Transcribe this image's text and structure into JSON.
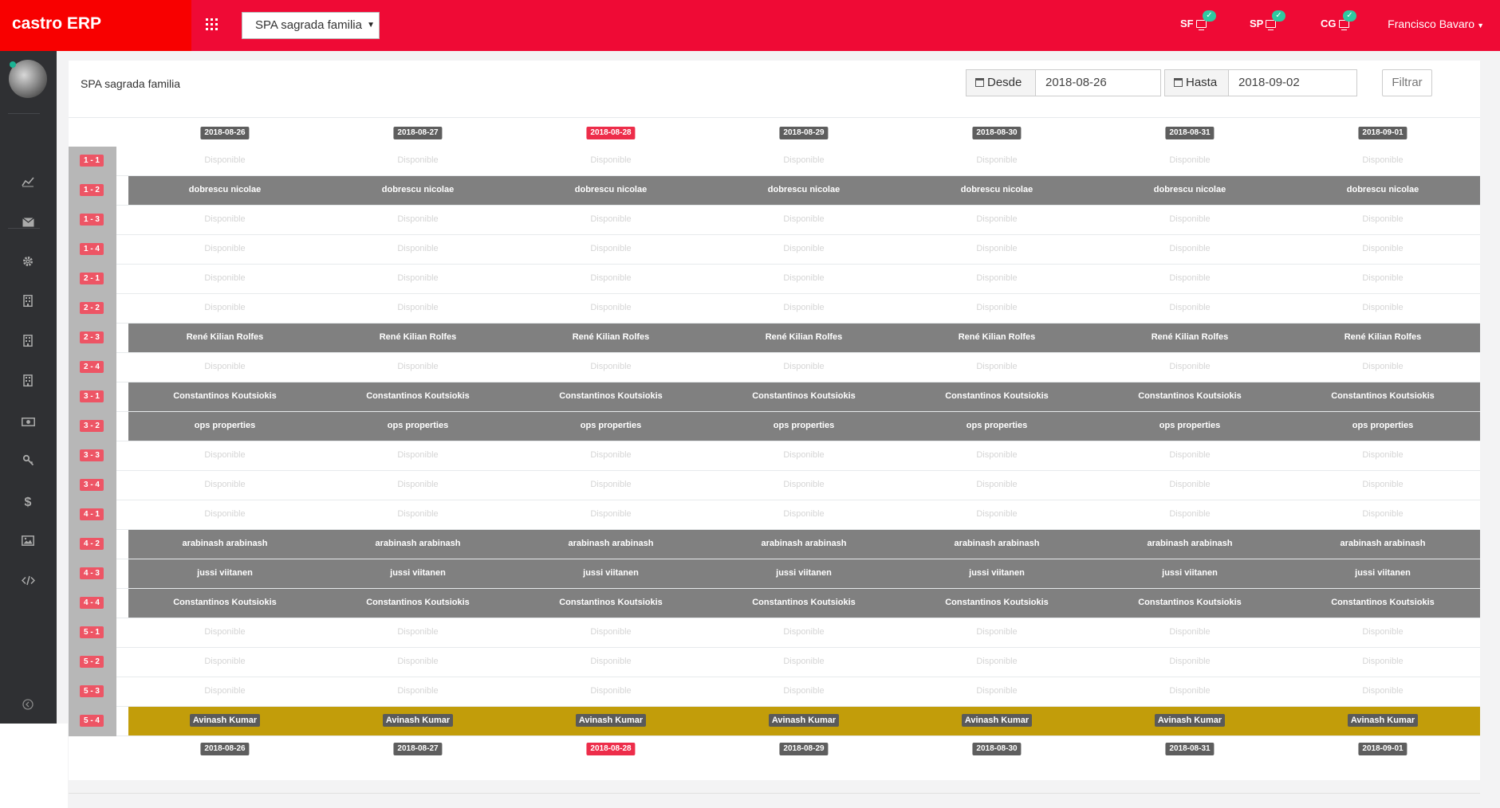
{
  "app": {
    "brand": "castro ERP",
    "company": "SPA sagrada familia",
    "user": "Francisco Bavaro"
  },
  "shops": [
    {
      "code": "SF",
      "status": "online"
    },
    {
      "code": "SP",
      "status": "online"
    },
    {
      "code": "CG",
      "status": "online"
    }
  ],
  "sidebar": {
    "items": [
      {
        "icon": "chart-line-icon"
      },
      {
        "icon": "envelope-icon"
      },
      {
        "icon": "gear-icon"
      },
      {
        "icon": "building-icon"
      },
      {
        "icon": "building-icon"
      },
      {
        "icon": "building-icon"
      },
      {
        "icon": "money-icon"
      },
      {
        "icon": "key-icon"
      },
      {
        "icon": "dollar-icon"
      },
      {
        "icon": "image-icon"
      },
      {
        "icon": "code-icon"
      }
    ],
    "collapse_icon": "circle-chevron-left-icon"
  },
  "page": {
    "title": "SPA sagrada familia"
  },
  "filter": {
    "from_label": "Desde",
    "from_value": "2018-08-26",
    "to_label": "Hasta",
    "to_value": "2018-09-02",
    "button": "Filtrar"
  },
  "dates": [
    "2018-08-26",
    "2018-08-27",
    "2018-08-28",
    "2018-08-29",
    "2018-08-30",
    "2018-08-31",
    "2018-09-01"
  ],
  "today": "2018-08-28",
  "free_text": "Disponible",
  "colors": {
    "topbar": "#ef0a35",
    "brand": "#f80000",
    "occupied": "#808080",
    "highlight": "#c29d0a",
    "room_badge": "#ed5565",
    "today_badge": "#ed2d4a"
  },
  "rows": [
    {
      "room": "1 - 1",
      "guest": null,
      "style": "free"
    },
    {
      "room": "1 - 2",
      "guest": "dobrescu nicolae",
      "style": "occ"
    },
    {
      "room": "1 - 3",
      "guest": null,
      "style": "free"
    },
    {
      "room": "1 - 4",
      "guest": null,
      "style": "free"
    },
    {
      "room": "2 - 1",
      "guest": null,
      "style": "free"
    },
    {
      "room": "2 - 2",
      "guest": null,
      "style": "free"
    },
    {
      "room": "2 - 3",
      "guest": "René Kilian Rolfes",
      "style": "occ"
    },
    {
      "room": "2 - 4",
      "guest": null,
      "style": "free"
    },
    {
      "room": "3 - 1",
      "guest": "Constantinos Koutsiokis",
      "style": "occ"
    },
    {
      "room": "3 - 2",
      "guest": "ops properties",
      "style": "occ"
    },
    {
      "room": "3 - 3",
      "guest": null,
      "style": "free"
    },
    {
      "room": "3 - 4",
      "guest": null,
      "style": "free"
    },
    {
      "room": "4 - 1",
      "guest": null,
      "style": "free"
    },
    {
      "room": "4 - 2",
      "guest": "arabinash arabinash",
      "style": "occ"
    },
    {
      "room": "4 - 3",
      "guest": "jussi viitanen",
      "style": "occ"
    },
    {
      "room": "4 - 4",
      "guest": "Constantinos Koutsiokis",
      "style": "occ"
    },
    {
      "room": "5 - 1",
      "guest": null,
      "style": "free"
    },
    {
      "room": "5 - 2",
      "guest": null,
      "style": "free"
    },
    {
      "room": "5 - 3",
      "guest": null,
      "style": "free"
    },
    {
      "room": "5 - 4",
      "guest": "Avinash Kumar",
      "style": "gold"
    }
  ]
}
